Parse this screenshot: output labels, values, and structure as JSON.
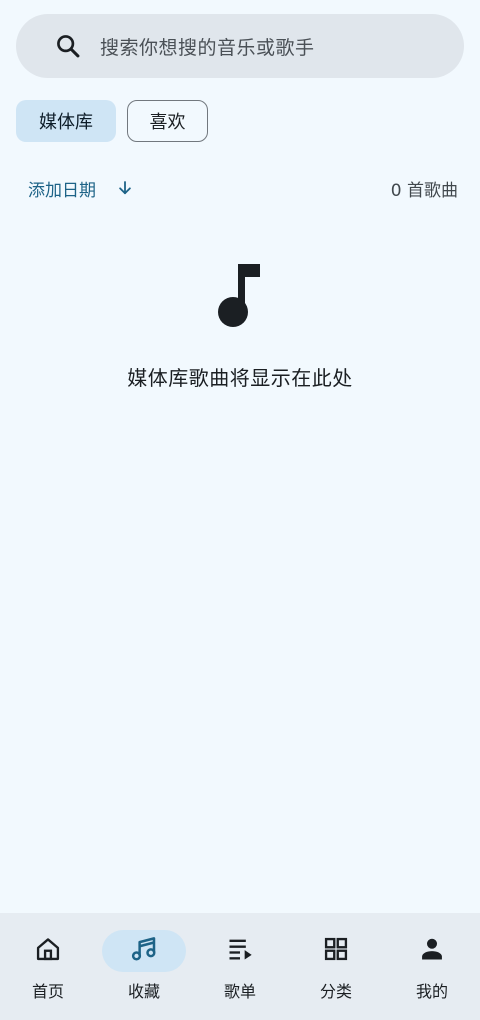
{
  "search": {
    "placeholder": "搜索你想搜的音乐或歌手",
    "icon": "search-icon"
  },
  "chips": [
    {
      "label": "媒体库",
      "selected": true
    },
    {
      "label": "喜欢",
      "selected": false
    }
  ],
  "sort": {
    "label": "添加日期",
    "direction_icon": "arrow-down-icon"
  },
  "song_count": "0 首歌曲",
  "empty_state": {
    "icon": "music-note-icon",
    "text": "媒体库歌曲将显示在此处"
  },
  "bottom_nav": [
    {
      "label": "首页",
      "icon": "home-icon",
      "active": false
    },
    {
      "label": "收藏",
      "icon": "music-notes-icon",
      "active": true
    },
    {
      "label": "歌单",
      "icon": "playlist-icon",
      "active": false
    },
    {
      "label": "分类",
      "icon": "grid-icon",
      "active": false
    },
    {
      "label": "我的",
      "icon": "person-icon",
      "active": false
    }
  ],
  "colors": {
    "background": "#f2f9fe",
    "accent": "#1d6387",
    "chip_selected": "#cfe5f5",
    "search_bg": "#e0e6ec",
    "nav_bg": "#e6ecf2"
  }
}
